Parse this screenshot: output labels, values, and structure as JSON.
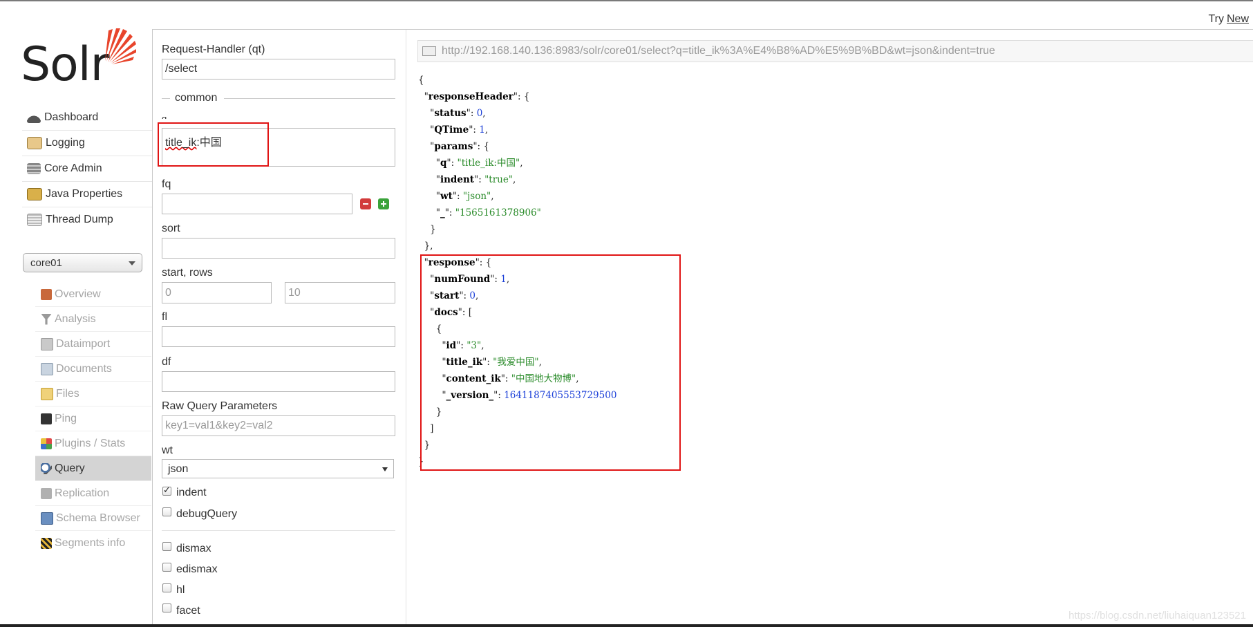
{
  "top": {
    "try_label": "Try",
    "try_link": "New"
  },
  "logo": {
    "text": "Solr"
  },
  "nav": [
    {
      "label": "Dashboard",
      "icon": "dashboard-icon"
    },
    {
      "label": "Logging",
      "icon": "logging-icon"
    },
    {
      "label": "Core Admin",
      "icon": "core-admin-icon"
    },
    {
      "label": "Java Properties",
      "icon": "java-properties-icon"
    },
    {
      "label": "Thread Dump",
      "icon": "thread-dump-icon"
    }
  ],
  "core_selector": {
    "value": "core01"
  },
  "core_nav": [
    {
      "label": "Overview",
      "icon": "overview-icon"
    },
    {
      "label": "Analysis",
      "icon": "analysis-icon"
    },
    {
      "label": "Dataimport",
      "icon": "dataimport-icon"
    },
    {
      "label": "Documents",
      "icon": "documents-icon"
    },
    {
      "label": "Files",
      "icon": "files-icon"
    },
    {
      "label": "Ping",
      "icon": "ping-icon"
    },
    {
      "label": "Plugins / Stats",
      "icon": "plugins-icon"
    },
    {
      "label": "Query",
      "icon": "query-icon",
      "active": true
    },
    {
      "label": "Replication",
      "icon": "replication-icon"
    },
    {
      "label": "Schema Browser",
      "icon": "schema-browser-icon"
    },
    {
      "label": "Segments info",
      "icon": "segments-icon"
    }
  ],
  "form": {
    "handler_label": "Request-Handler (qt)",
    "handler_value": "/select",
    "common_legend": "common",
    "q_label": "q",
    "q_value_field": "title_ik",
    "q_value_term": ":中国",
    "fq_label": "fq",
    "sort_label": "sort",
    "start_rows_label": "start, rows",
    "start_placeholder": "0",
    "rows_placeholder": "10",
    "fl_label": "fl",
    "df_label": "df",
    "raw_label": "Raw Query Parameters",
    "raw_placeholder": "key1=val1&key2=val2",
    "wt_label": "wt",
    "wt_value": "json",
    "indent_label": "indent",
    "debug_label": "debugQuery",
    "dismax_label": "dismax",
    "edismax_label": "edismax",
    "hl_label": "hl",
    "facet_label": "facet"
  },
  "url": "http://192.168.140.136:8983/solr/core01/select?q=title_ik%3A%E4%B8%AD%E5%9B%BD&wt=json&indent=true",
  "json_lines": [
    [
      [
        "p",
        "{"
      ]
    ],
    [
      [
        "p",
        "  \""
      ],
      [
        "k",
        "responseHeader"
      ],
      [
        "p",
        "\": {"
      ]
    ],
    [
      [
        "p",
        "    \""
      ],
      [
        "k",
        "status"
      ],
      [
        "p",
        "\": "
      ],
      [
        "n",
        "0"
      ],
      [
        "p",
        ","
      ]
    ],
    [
      [
        "p",
        "    \""
      ],
      [
        "k",
        "QTime"
      ],
      [
        "p",
        "\": "
      ],
      [
        "n",
        "1"
      ],
      [
        "p",
        ","
      ]
    ],
    [
      [
        "p",
        "    \""
      ],
      [
        "k",
        "params"
      ],
      [
        "p",
        "\": {"
      ]
    ],
    [
      [
        "p",
        "      \""
      ],
      [
        "k",
        "q"
      ],
      [
        "p",
        "\": "
      ],
      [
        "s",
        "\"title_ik:中国\""
      ],
      [
        "p",
        ","
      ]
    ],
    [
      [
        "p",
        "      \""
      ],
      [
        "k",
        "indent"
      ],
      [
        "p",
        "\": "
      ],
      [
        "s",
        "\"true\""
      ],
      [
        "p",
        ","
      ]
    ],
    [
      [
        "p",
        "      \""
      ],
      [
        "k",
        "wt"
      ],
      [
        "p",
        "\": "
      ],
      [
        "s",
        "\"json\""
      ],
      [
        "p",
        ","
      ]
    ],
    [
      [
        "p",
        "      \""
      ],
      [
        "k",
        "_"
      ],
      [
        "p",
        "\": "
      ],
      [
        "s",
        "\"1565161378906\""
      ]
    ],
    [
      [
        "p",
        "    }"
      ]
    ],
    [
      [
        "p",
        "  },"
      ]
    ],
    [
      [
        "p",
        "  \""
      ],
      [
        "k",
        "response"
      ],
      [
        "p",
        "\": {"
      ]
    ],
    [
      [
        "p",
        "    \""
      ],
      [
        "k",
        "numFound"
      ],
      [
        "p",
        "\": "
      ],
      [
        "n",
        "1"
      ],
      [
        "p",
        ","
      ]
    ],
    [
      [
        "p",
        "    \""
      ],
      [
        "k",
        "start"
      ],
      [
        "p",
        "\": "
      ],
      [
        "n",
        "0"
      ],
      [
        "p",
        ","
      ]
    ],
    [
      [
        "p",
        "    \""
      ],
      [
        "k",
        "docs"
      ],
      [
        "p",
        "\": ["
      ]
    ],
    [
      [
        "p",
        "      {"
      ]
    ],
    [
      [
        "p",
        "        \""
      ],
      [
        "k",
        "id"
      ],
      [
        "p",
        "\": "
      ],
      [
        "s",
        "\"3\""
      ],
      [
        "p",
        ","
      ]
    ],
    [
      [
        "p",
        "        \""
      ],
      [
        "k",
        "title_ik"
      ],
      [
        "p",
        "\": "
      ],
      [
        "s",
        "\"我爱中国\""
      ],
      [
        "p",
        ","
      ]
    ],
    [
      [
        "p",
        "        \""
      ],
      [
        "k",
        "content_ik"
      ],
      [
        "p",
        "\": "
      ],
      [
        "s",
        "\"中国地大物博\""
      ],
      [
        "p",
        ","
      ]
    ],
    [
      [
        "p",
        "        \""
      ],
      [
        "k",
        "_version_"
      ],
      [
        "p",
        "\": "
      ],
      [
        "n",
        "1641187405553729500"
      ]
    ],
    [
      [
        "p",
        "      }"
      ]
    ],
    [
      [
        "p",
        "    ]"
      ]
    ],
    [
      [
        "p",
        "  }"
      ]
    ],
    [
      [
        "p",
        "}"
      ]
    ]
  ],
  "watermark": "https://blog.csdn.net/liuhaiquan123521"
}
